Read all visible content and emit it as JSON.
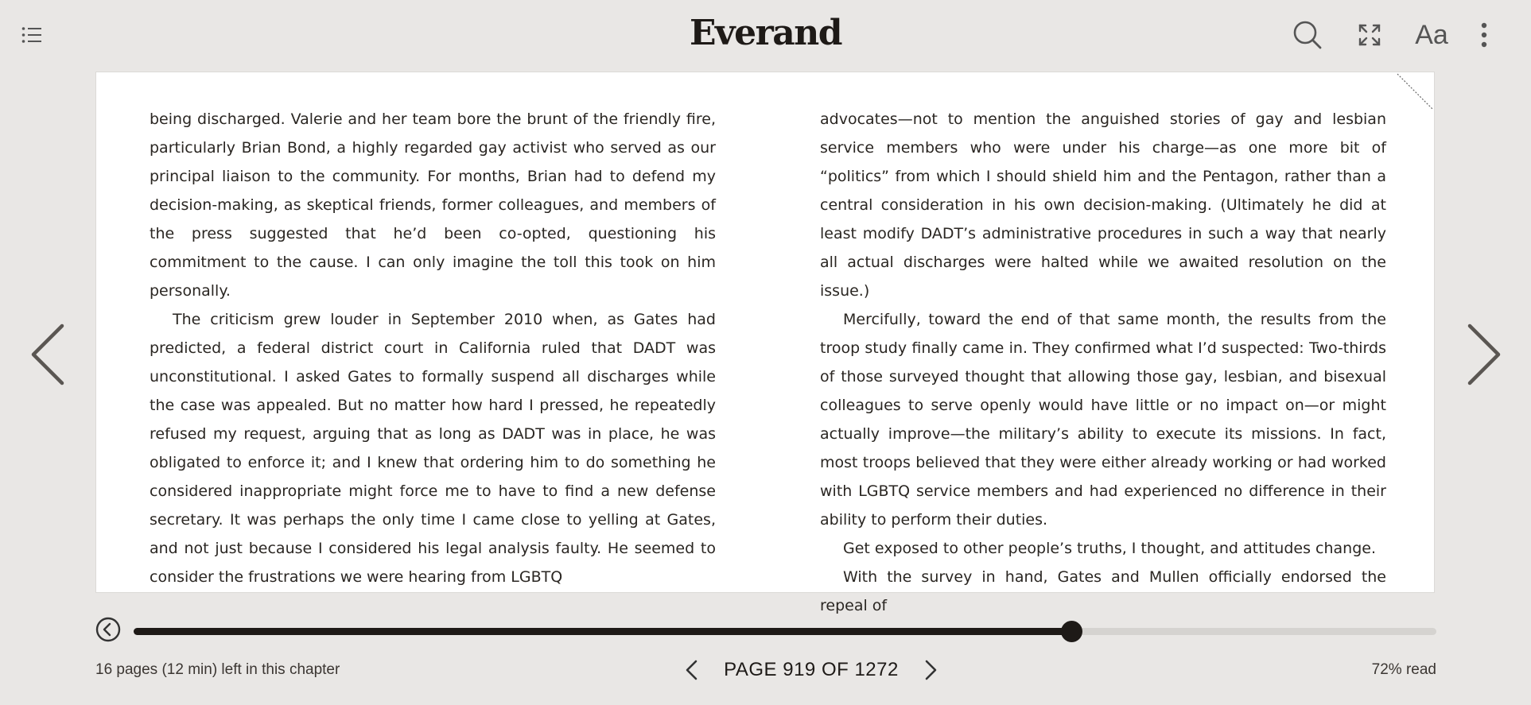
{
  "header": {
    "logo": "Everand",
    "font_settings_label": "Aa",
    "icons": {
      "toc": "table-of-contents-icon",
      "search": "search-icon",
      "fullscreen": "fullscreen-icon",
      "font": "font-settings-icon",
      "more": "more-vertical-icon"
    }
  },
  "book": {
    "left_column": [
      {
        "text": "being discharged. Valerie and her team bore the brunt of the friendly fire, particularly Brian Bond, a highly regarded gay activist who served as our principal liaison to the community. For months, Brian had to defend my decision-making, as skeptical friends, former colleagues, and members of the press suggested that he’d been co-opted, questioning his commitment to the cause. I can only imagine the toll this took on him personally.",
        "indent": false
      },
      {
        "text": "The criticism grew louder in September 2010 when, as Gates had predicted, a federal district court in California ruled that DADT was unconstitutional. I asked Gates to formally suspend all discharges while the case was appealed. But no matter how hard I pressed, he repeatedly refused my request, arguing that as long as DADT was in place, he was obligated to enforce it; and I knew that ordering him to do something he considered inappropriate might force me to have to find a new defense secretary. It was perhaps the only time I came close to yelling at Gates, and not just because I considered his legal analysis faulty. He seemed to consider the frustrations we were hearing from LGBTQ",
        "indent": true
      }
    ],
    "right_column": [
      {
        "text": "advocates—not to mention the anguished stories of gay and lesbian service members who were under his charge—as one more bit of “politics” from which I should shield him and the Pentagon, rather than a central consideration in his own decision-making. (Ultimately he did at least modify DADT’s administrative procedures in such a way that nearly all actual discharges were halted while we awaited resolution on the issue.)",
        "indent": false
      },
      {
        "text": "Mercifully, toward the end of that same month, the results from the troop study finally came in. They confirmed what I’d suspected: Two-thirds of those surveyed thought that allowing those gay, lesbian, and bisexual colleagues to serve openly would have little or no impact on—or might actually improve—the military’s ability to execute its missions. In fact, most troops believed that they were either already working or had worked with LGBTQ service members and had experienced no difference in their ability to perform their duties.",
        "indent": true
      },
      {
        "text": "Get exposed to other people’s truths, I thought, and attitudes change.",
        "indent": true
      },
      {
        "text": "With the survey in hand, Gates and Mullen officially endorsed the repeal of",
        "indent": true
      }
    ]
  },
  "navigation": {
    "prev_icon": "chevron-left-icon",
    "next_icon": "chevron-right-icon"
  },
  "progress": {
    "fraction_read": 0.72,
    "back_icon": "back-circle-icon"
  },
  "footer": {
    "chapter_remaining": "16 pages (12 min) left in this chapter",
    "page_label": "PAGE 919 OF 1272",
    "percent_read": "72% read"
  },
  "colors": {
    "background": "#e9e7e5",
    "page": "#ffffff",
    "ink": "#1e1a17",
    "track": "#d5d3d0"
  }
}
